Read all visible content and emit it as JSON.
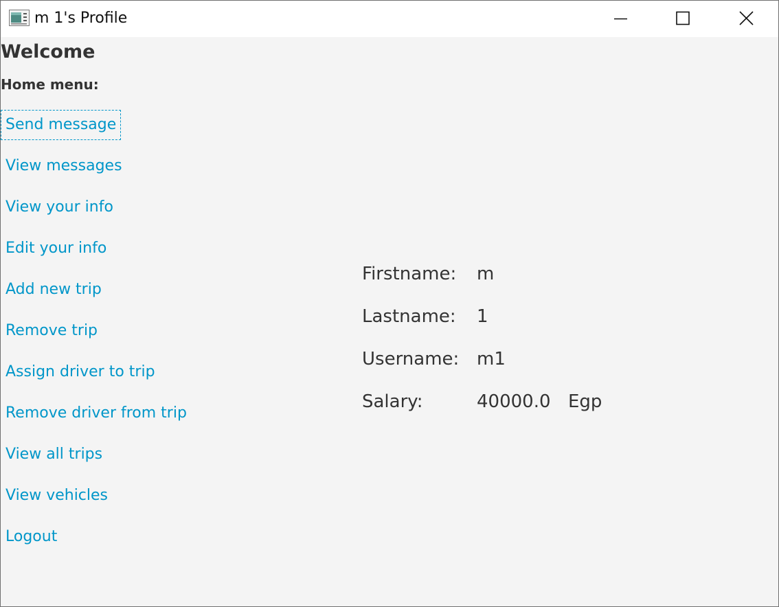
{
  "window": {
    "title": "m 1's Profile",
    "icon": "app-window-icon",
    "controls": [
      "minimize-icon",
      "maximize-icon",
      "close-icon"
    ]
  },
  "header": {
    "welcome": "Welcome",
    "home_menu": "Home menu:"
  },
  "menu": {
    "items": [
      {
        "label": "Send message"
      },
      {
        "label": "View messages"
      },
      {
        "label": "View your info"
      },
      {
        "label": "Edit your info"
      },
      {
        "label": "Add new trip"
      },
      {
        "label": "Remove trip"
      },
      {
        "label": "Assign driver to trip"
      },
      {
        "label": "Remove driver from trip"
      },
      {
        "label": "View all trips"
      },
      {
        "label": "View vehicles"
      },
      {
        "label": "Logout"
      }
    ],
    "focused_item": "Send message"
  },
  "info": {
    "firstname_label": "Firstname:",
    "firstname_value": "m",
    "lastname_label": "Lastname:",
    "lastname_value": "1",
    "username_label": "Username:",
    "username_value": "m1",
    "salary_label": "Salary:",
    "salary_value": "40000.0",
    "salary_unit": "Egp"
  },
  "colors": {
    "link": "#0096c9",
    "text": "#333333",
    "background": "#f4f4f4",
    "titlebar": "#ffffff"
  }
}
